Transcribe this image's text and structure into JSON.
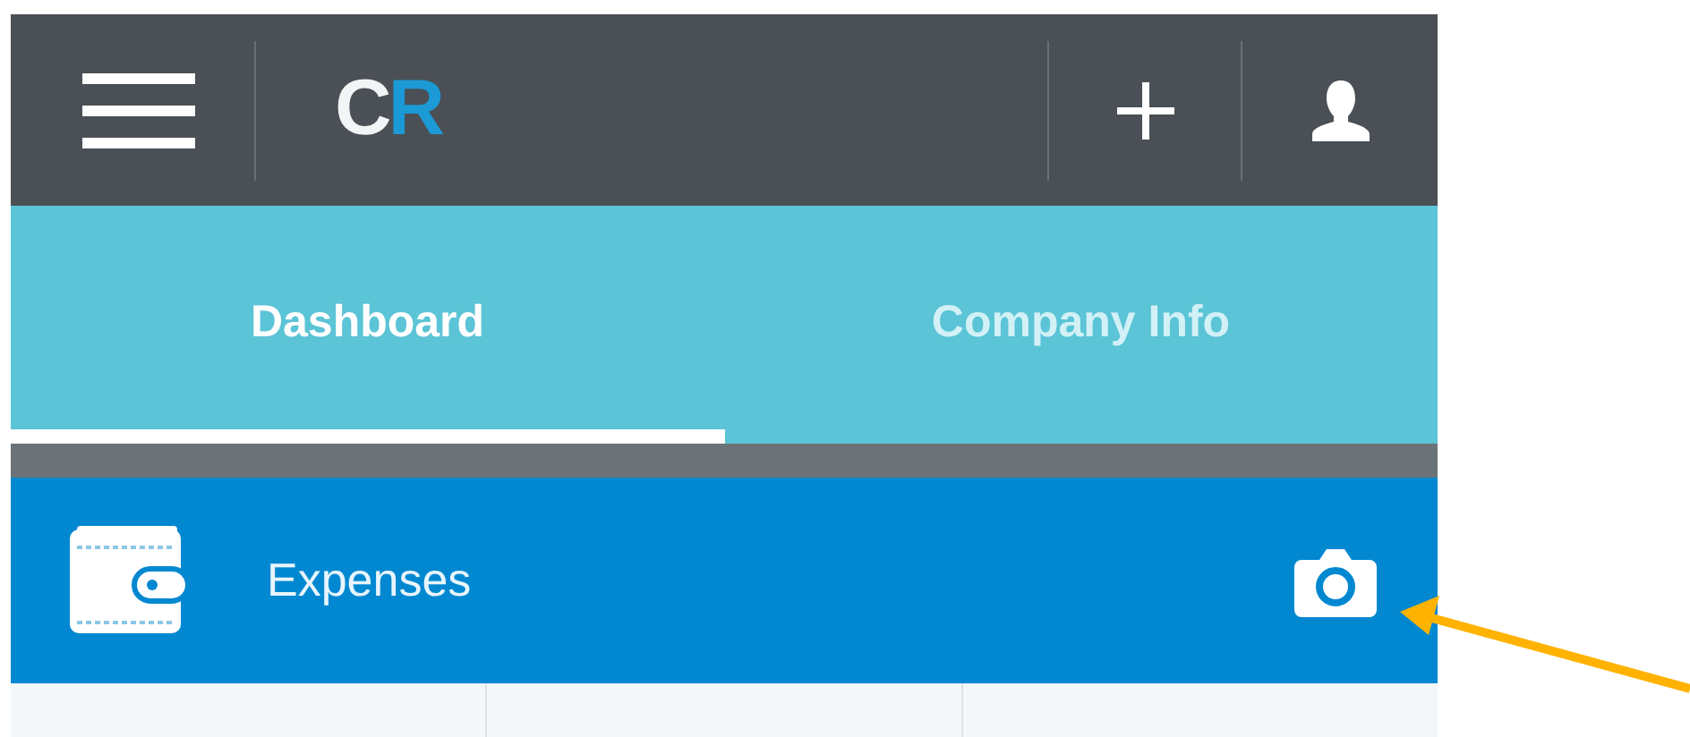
{
  "app_bar": {
    "logo": "CR"
  },
  "tabs": [
    {
      "label": "Dashboard",
      "selected": true
    },
    {
      "label": "Company Info",
      "selected": false
    }
  ],
  "section_header": {
    "title": "Expenses"
  }
}
